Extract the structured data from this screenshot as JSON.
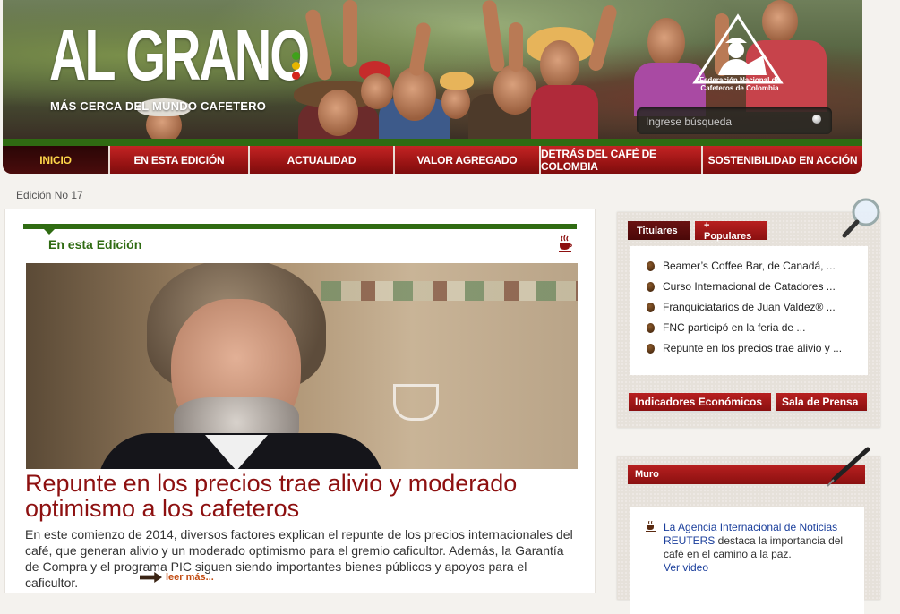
{
  "header": {
    "logo_title": "AL GRANO",
    "logo_subtitle": "MÁS CERCA DEL MUNDO CAFETERO",
    "org_name_line1": "Federación Nacional de",
    "org_name_line2": "Cafeteros de Colombia",
    "search_placeholder": "Ingrese búsqueda",
    "dot_colors": [
      "#3fa11a",
      "#e6b500",
      "#d4261a"
    ]
  },
  "nav": {
    "items": [
      {
        "label": "INICIO",
        "active": true
      },
      {
        "label": "EN ESTA EDICIÓN",
        "active": false
      },
      {
        "label": "ACTUALIDAD",
        "active": false
      },
      {
        "label": "VALOR AGREGADO",
        "active": false
      },
      {
        "label": "DETRÁS DEL CAFÉ DE COLOMBIA",
        "active": false
      },
      {
        "label": "SOSTENIBILIDAD EN ACCIÓN",
        "active": false
      }
    ]
  },
  "edition": "Edición No 17",
  "main": {
    "section_title": "En esta Edición",
    "headline": "Repunte en los precios trae alivio y moderado optimismo a los cafeteros",
    "summary": "En este comienzo de 2014, diversos factores explican el repunte de los precios internacionales del café, que generan alivio y un moderado optimismo para el gremio caficultor. Además, la Garantía de Compra y el programa PIC siguen siendo importantes bienes públicos y apoyos para el caficultor.",
    "read_more": "leer más..."
  },
  "sidebar": {
    "tabs": [
      "Titulares",
      "+ Populares"
    ],
    "headlines": [
      "Beamer’s Coffee Bar, de Canadá, ...",
      "Curso Internacional de Catadores ...",
      "Franquiciatarios de Juan Valdez® ...",
      "FNC participó en la feria de ...",
      "Repunte en los precios trae alivio y ..."
    ],
    "buttons": [
      "Indicadores Económicos",
      "Sala de Prensa"
    ]
  },
  "muro": {
    "title": "Muro",
    "link_text": "La Agencia Internacional de Noticias REUTERS",
    "body_text": " destaca la importancia del café en el camino a la paz.",
    "video_link": "Ver video"
  },
  "colors": {
    "brand_red": "#9a1414",
    "brand_green": "#2f6b12",
    "headline_red": "#8d1010",
    "active_nav_text": "#ffd84a"
  }
}
